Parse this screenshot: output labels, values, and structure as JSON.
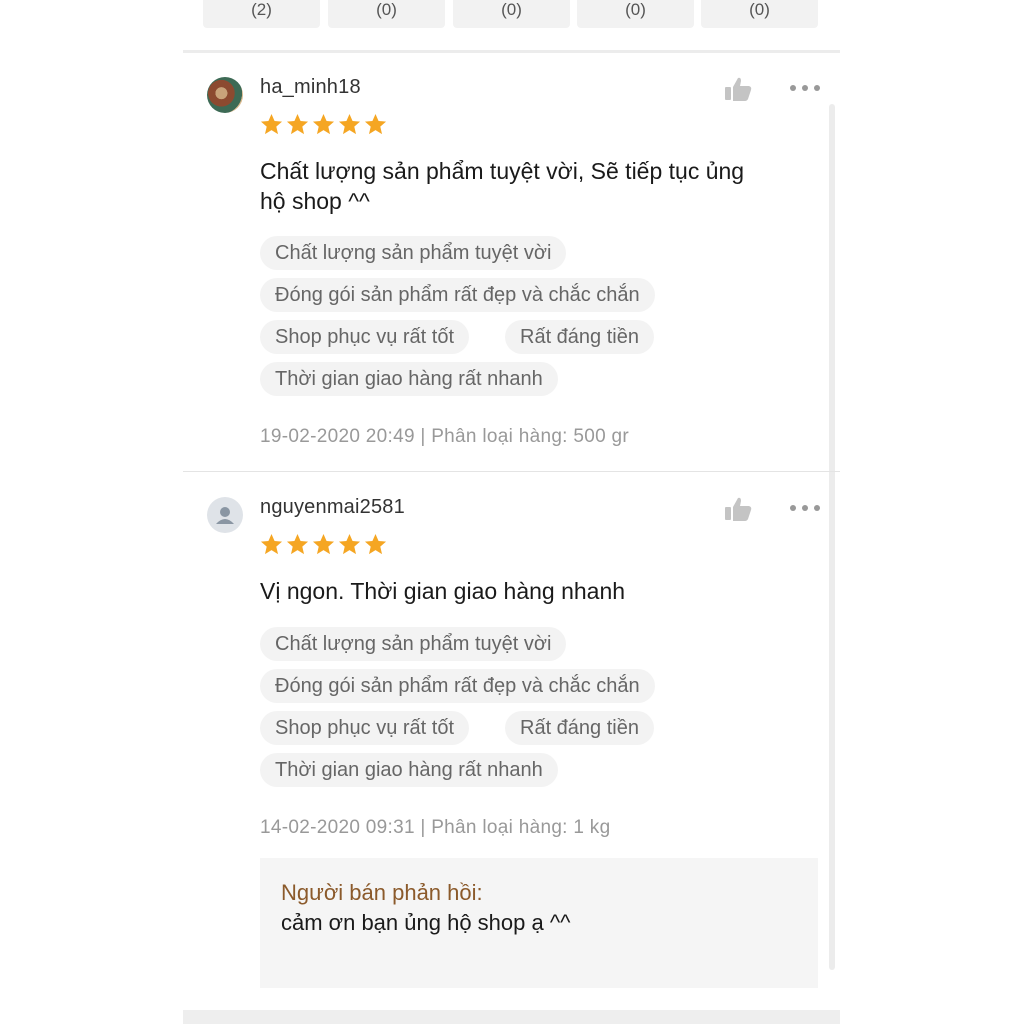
{
  "filters": [
    {
      "count": "(2)"
    },
    {
      "count": "(0)"
    },
    {
      "count": "(0)"
    },
    {
      "count": "(0)"
    },
    {
      "count": "(0)"
    }
  ],
  "colors": {
    "star": "#f5a623",
    "seller_label": "#8b5a2b",
    "like_icon": "#c4c4c4"
  },
  "reviews": [
    {
      "username": "ha_minh18",
      "rating": 5,
      "comment_line1": "Chất lượng sản phẩm tuyệt vời, Sẽ tiếp tục ủng",
      "comment_line2": "hộ shop ^^",
      "tags": [
        "Chất lượng sản phẩm tuyệt vời",
        "Đóng gói sản phẩm rất đẹp và chắc chắn",
        "Shop phục vụ rất tốt",
        "Rất đáng tiền",
        "Thời gian giao hàng rất nhanh"
      ],
      "meta": "19-02-2020 20:49 | Phân loại hàng: 500 gr"
    },
    {
      "username": "nguyenmai2581",
      "rating": 5,
      "comment_line1": "Vị ngon. Thời gian giao hàng nhanh",
      "tags": [
        "Chất lượng sản phẩm tuyệt vời",
        "Đóng gói sản phẩm rất đẹp và chắc chắn",
        "Shop phục vụ rất tốt",
        "Rất đáng tiền",
        "Thời gian giao hàng rất nhanh"
      ],
      "meta": "14-02-2020 09:31 | Phân loại hàng: 1 kg",
      "seller_reply": {
        "label": "Người bán phản hồi:",
        "text": "cảm ơn bạn ủng hộ shop ạ ^^"
      }
    }
  ]
}
